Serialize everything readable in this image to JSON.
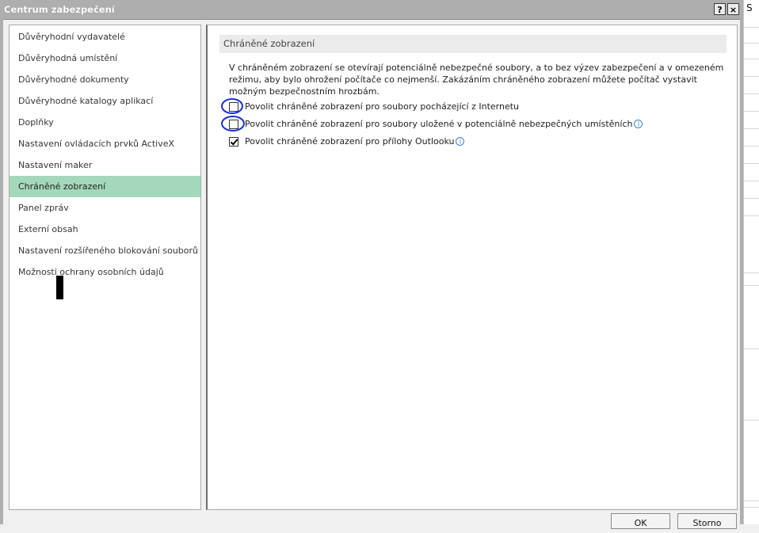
{
  "window": {
    "title": "Centrum zabezpečení",
    "help_button": "?",
    "close_button": "×"
  },
  "sidebar": {
    "items": [
      {
        "label": "Důvěryhodní vydavatelé"
      },
      {
        "label": "Důvěryhodná umístění"
      },
      {
        "label": "Důvěryhodné dokumenty"
      },
      {
        "label": "Důvěryhodné katalogy aplikací"
      },
      {
        "label": "Doplňky"
      },
      {
        "label": "Nastavení ovládacích prvků ActiveX"
      },
      {
        "label": "Nastavení maker"
      },
      {
        "label": "Chráněné zobrazení",
        "selected": true
      },
      {
        "label": "Panel zpráv"
      },
      {
        "label": "Externí obsah"
      },
      {
        "label": "Nastavení rozšířeného blokování souborů"
      },
      {
        "label": "Možnosti ochrany osobních údajů"
      }
    ]
  },
  "main": {
    "section_title": "Chráněné zobrazení",
    "description": "V chráněném zobrazení se otevírají potenciálně nebezpečné soubory, a to bez výzev zabezpečení a v omezeném režimu, aby bylo ohrožení počítače co nejmenší. Zakázáním chráněného zobrazení můžete počítač vystavit možným bezpečnostním hrozbám.",
    "options": [
      {
        "label": "Povolit chráněné zobrazení pro soubory pocházející z Internetu",
        "checked": false,
        "info_icon": false
      },
      {
        "label": "Povolit chráněné zobrazení pro soubory uložené v potenciálně nebezpečných umístěních",
        "checked": false,
        "info_icon": true
      },
      {
        "label": "Povolit chráněné zobrazení pro přílohy Outlooku",
        "checked": true,
        "info_icon": true
      }
    ]
  },
  "footer": {
    "ok_label": "OK",
    "cancel_label": "Storno"
  },
  "background_window": {
    "edge_text": "S"
  },
  "colors": {
    "selected_item": "#a4d8ba",
    "titlebar": "#aeaeae",
    "annotation_circle": "#1a2fcf",
    "info_icon": "#3d7fd4"
  }
}
